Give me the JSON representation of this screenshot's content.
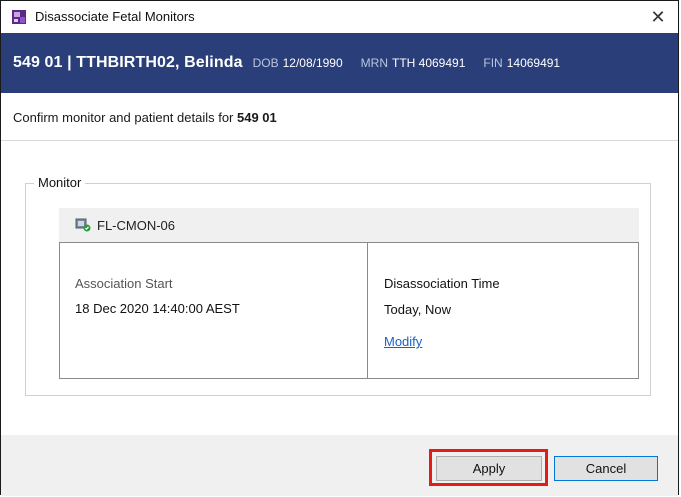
{
  "window": {
    "title": "Disassociate Fetal Monitors",
    "close_symbol": "✕"
  },
  "banner": {
    "patient": "549 01 | TTHBIRTH02, Belinda",
    "dob_label": "DOB",
    "dob": "12/08/1990",
    "mrn_label": "MRN",
    "mrn": "TTH 4069491",
    "fin_label": "FIN",
    "fin": "14069491"
  },
  "confirm": {
    "text": "Confirm monitor and patient details for ",
    "bed": "549 01"
  },
  "monitor_group": {
    "legend": "Monitor",
    "monitor_name": "FL-CMON-06",
    "association_start_label": "Association Start",
    "association_start_value": "18 Dec 2020 14:40:00 AEST",
    "disassociation_time_label": "Disassociation Time",
    "disassociation_time_value": "Today, Now",
    "modify_label": "Modify"
  },
  "buttons": {
    "apply": "Apply",
    "cancel": "Cancel"
  },
  "colors": {
    "banner_bg": "#2a3f7a",
    "link": "#1a62c6",
    "highlight": "#e31b1b",
    "cancel_border": "#0078d7"
  },
  "icons": {
    "app": "fetal-monitor-app-icon",
    "monitor": "monitor-device-icon",
    "close": "close-icon"
  }
}
